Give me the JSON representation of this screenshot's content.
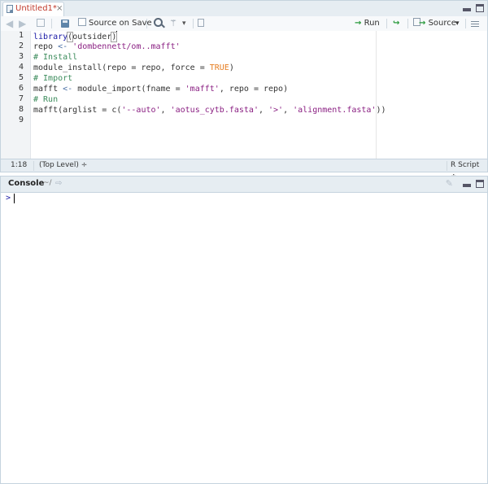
{
  "editor": {
    "tab": {
      "title": "Untitled1*",
      "close": "×"
    },
    "toolbar": {
      "source_on_save": "Source on Save",
      "run": "Run",
      "source": "Source",
      "run_icon": "→",
      "rerun_icon": "↪",
      "dropdown": "▾"
    },
    "lines": [
      "1",
      "2",
      "3",
      "4",
      "5",
      "6",
      "7",
      "8",
      "9"
    ],
    "code": {
      "l1_fn": "library",
      "l1_open": "(",
      "l1_arg": "outsider",
      "l1_close": ")",
      "l2_var": "repo ",
      "l2_op": "<-",
      "l2_str": " 'dombennett/om..mafft'",
      "l3": "# Install",
      "l4_a": "module_install(repo = repo, force = ",
      "l4_const": "TRUE",
      "l4_b": ")",
      "l5": "# Import",
      "l6_a": "mafft ",
      "l6_op": "<-",
      "l6_b": " module_import(fname = ",
      "l6_str": "'mafft'",
      "l6_c": ", repo = repo)",
      "l7": "# Run",
      "l8_a": "mafft(arglist = c(",
      "l8_s1": "'--auto'",
      "l8_c1": ", ",
      "l8_s2": "'aotus_cytb.fasta'",
      "l8_c2": ", ",
      "l8_s3": "'>'",
      "l8_c3": ", ",
      "l8_s4": "'alignment.fasta'",
      "l8_b": "))"
    },
    "status": {
      "position": "1:18",
      "scope": "(Top Level) ÷",
      "filetype": "R Script ÷"
    },
    "colors": {
      "string": "#8a1f82",
      "function": "#1a1aa6",
      "comment": "#3c8c5c",
      "constant": "#e67e22"
    }
  },
  "console": {
    "title": "Console",
    "dir": "~/",
    "prompt": ">"
  }
}
